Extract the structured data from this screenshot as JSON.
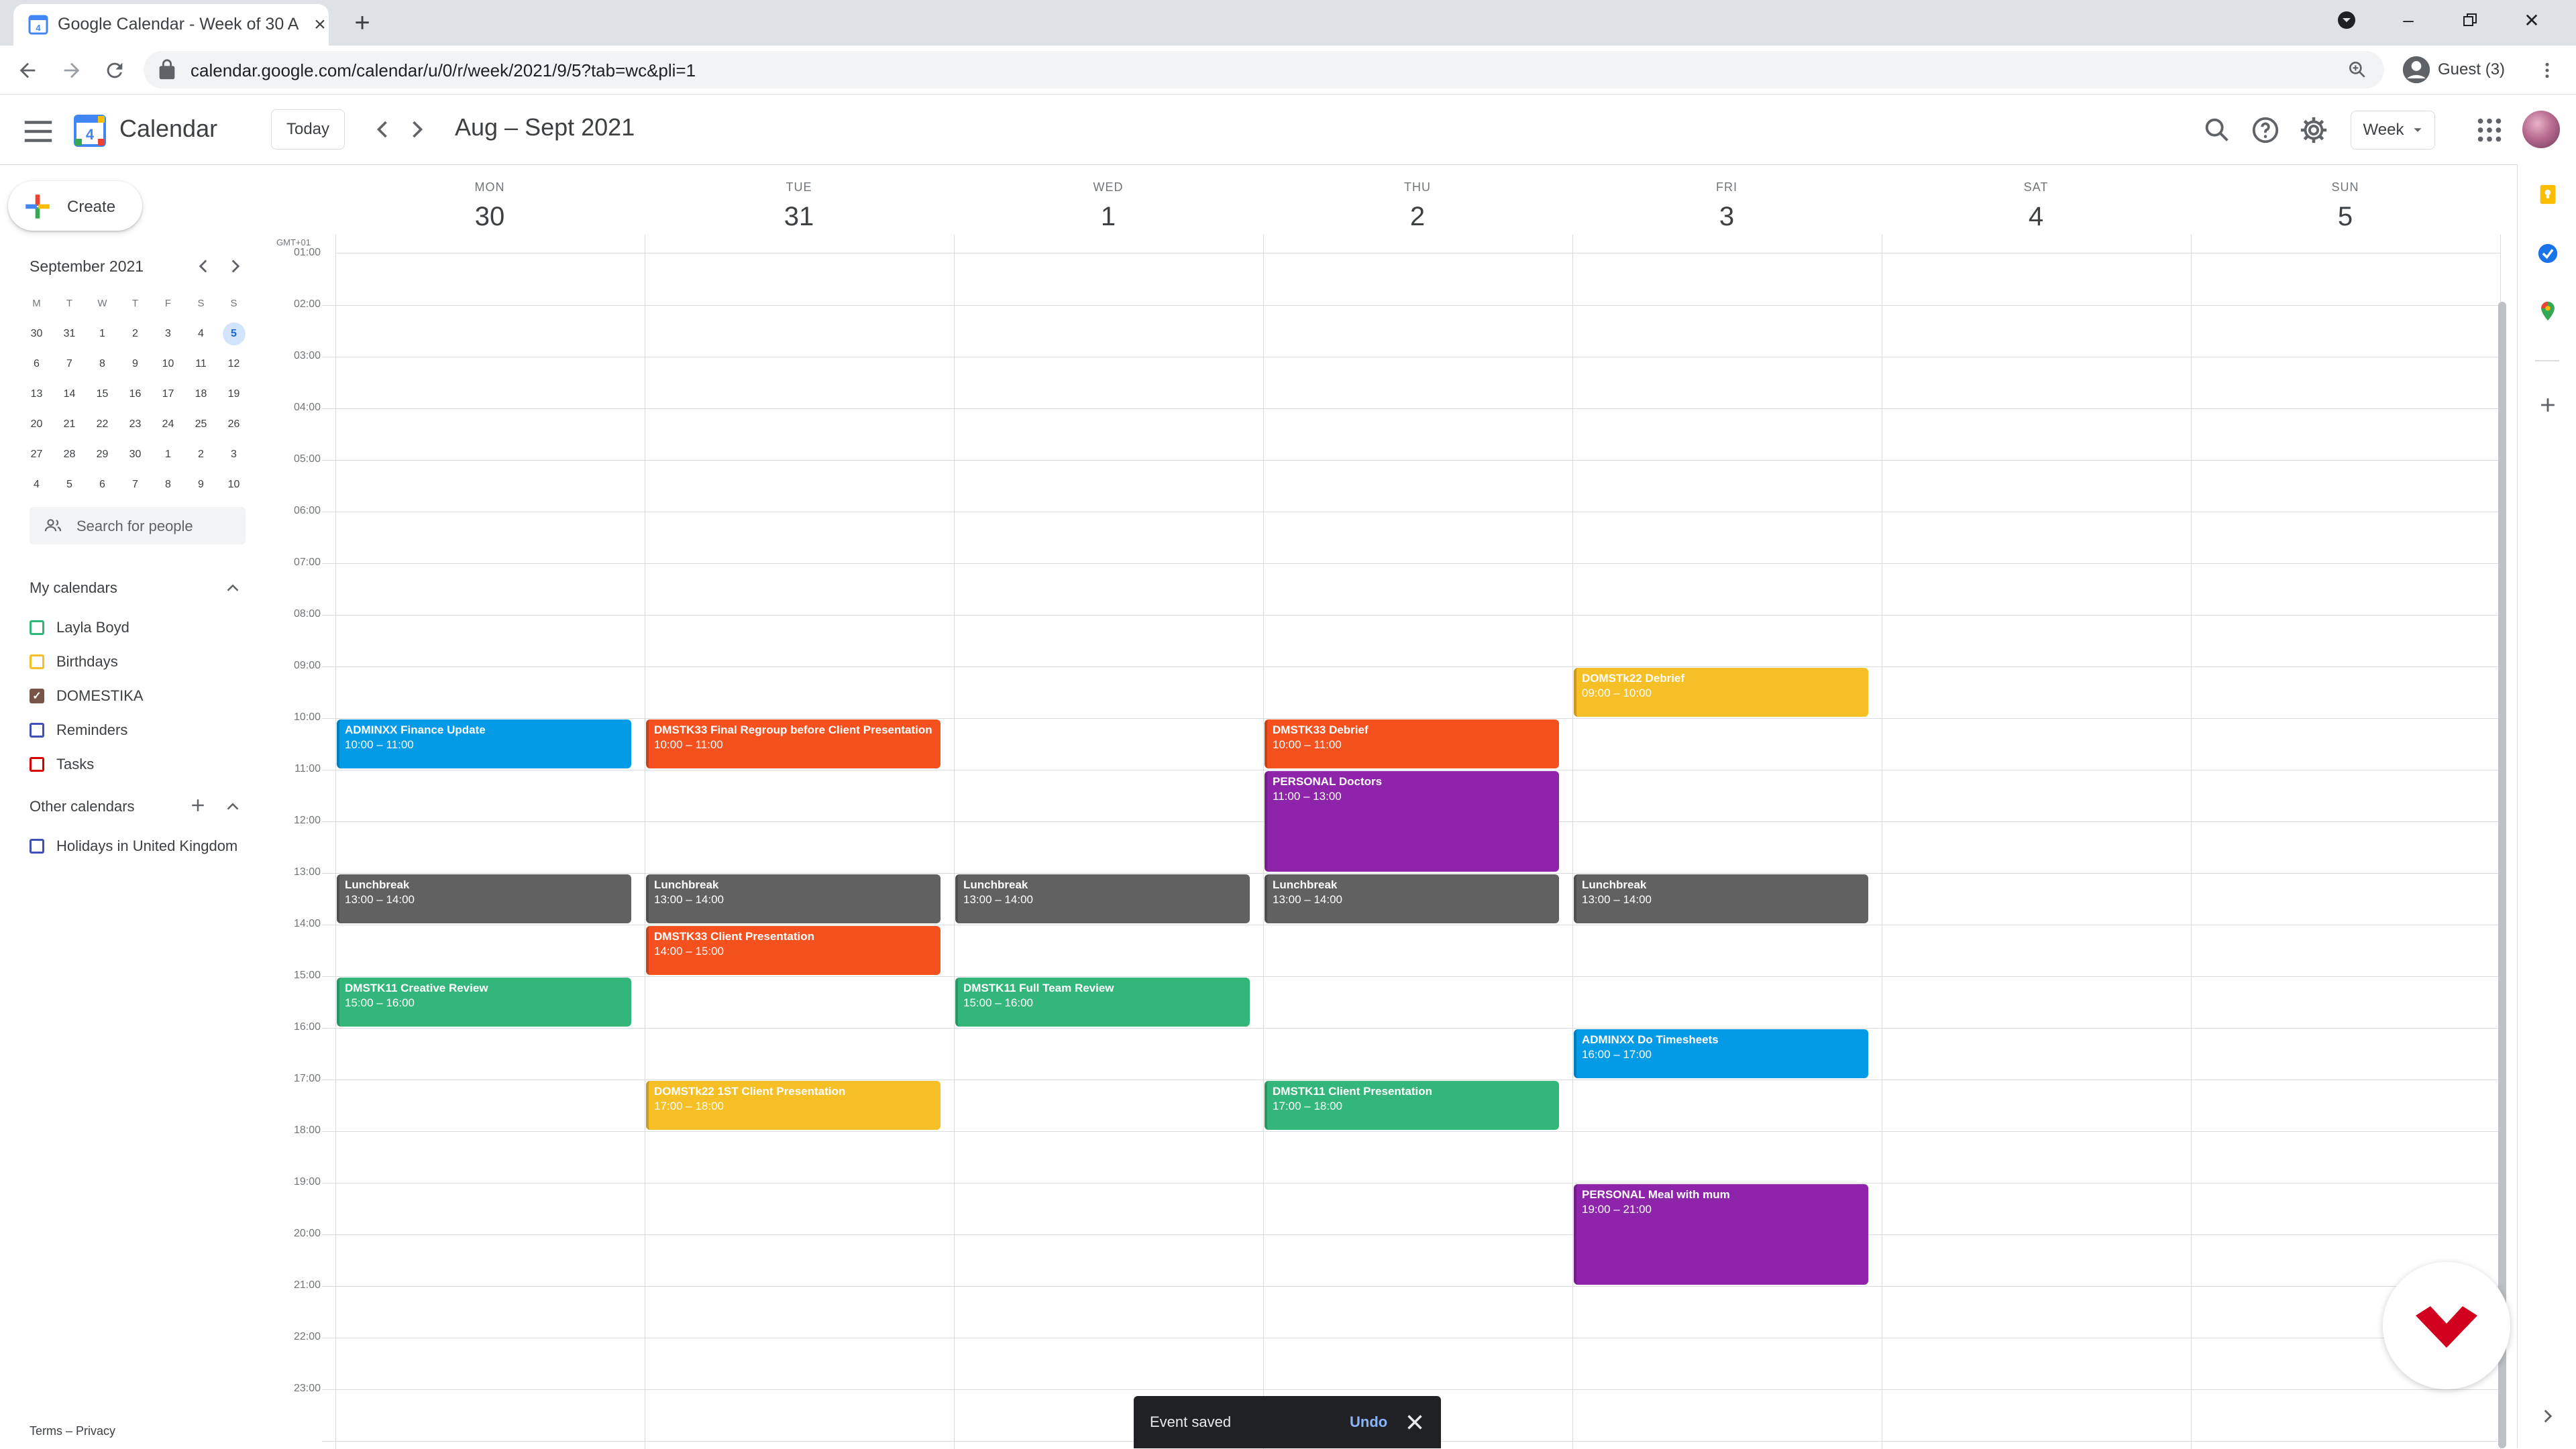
{
  "browser": {
    "tab_title": "Google Calendar - Week of 30 A",
    "url": "calendar.google.com/calendar/u/0/r/week/2021/9/5?tab=wc&pli=1",
    "profile_label": "Guest (3)"
  },
  "header": {
    "app_name": "Calendar",
    "today_label": "Today",
    "range_title": "Aug – Sept 2021",
    "view_label": "Week"
  },
  "sidebar": {
    "create_label": "Create",
    "mini_calendar": {
      "title": "September 2021",
      "weekdays": [
        "M",
        "T",
        "W",
        "T",
        "F",
        "S",
        "S"
      ],
      "weeks": [
        [
          "30",
          "31",
          "1",
          "2",
          "3",
          "4",
          "5"
        ],
        [
          "6",
          "7",
          "8",
          "9",
          "10",
          "11",
          "12"
        ],
        [
          "13",
          "14",
          "15",
          "16",
          "17",
          "18",
          "19"
        ],
        [
          "20",
          "21",
          "22",
          "23",
          "24",
          "25",
          "26"
        ],
        [
          "27",
          "28",
          "29",
          "30",
          "1",
          "2",
          "3"
        ],
        [
          "4",
          "5",
          "6",
          "7",
          "8",
          "9",
          "10"
        ]
      ],
      "today": "5"
    },
    "search_people_placeholder": "Search for people",
    "my_calendars_label": "My calendars",
    "my_calendars": [
      {
        "name": "Layla Boyd",
        "color": "#33b679",
        "checked": false
      },
      {
        "name": "Birthdays",
        "color": "#f6bf26",
        "checked": false
      },
      {
        "name": "DOMESTIKA",
        "color": "#795548",
        "checked": true
      },
      {
        "name": "Reminders",
        "color": "#3f51b5",
        "checked": false
      },
      {
        "name": "Tasks",
        "color": "#d50000",
        "checked": false
      }
    ],
    "other_calendars_label": "Other calendars",
    "other_calendars": [
      {
        "name": "Holidays in United Kingdom",
        "color": "#3f51b5",
        "checked": false
      }
    ],
    "footer": "Terms – Privacy"
  },
  "week": {
    "timezone": "GMT+01",
    "days": [
      {
        "name": "MON",
        "num": "30"
      },
      {
        "name": "TUE",
        "num": "31"
      },
      {
        "name": "WED",
        "num": "1"
      },
      {
        "name": "THU",
        "num": "2"
      },
      {
        "name": "FRI",
        "num": "3"
      },
      {
        "name": "SAT",
        "num": "4"
      },
      {
        "name": "SUN",
        "num": "5"
      }
    ],
    "hours": [
      "01:00",
      "02:00",
      "03:00",
      "04:00",
      "05:00",
      "06:00",
      "07:00",
      "08:00",
      "09:00",
      "10:00",
      "11:00",
      "12:00",
      "13:00",
      "14:00",
      "15:00",
      "16:00",
      "17:00",
      "18:00",
      "19:00",
      "20:00",
      "21:00",
      "22:00",
      "23:00"
    ],
    "events": [
      {
        "day": 0,
        "start": 10,
        "end": 11,
        "title": "ADMINXX Finance Update",
        "time": "10:00 – 11:00",
        "color": "#039be5"
      },
      {
        "day": 0,
        "start": 13,
        "end": 14,
        "title": "Lunchbreak",
        "time": "13:00 – 14:00",
        "color": "#616161"
      },
      {
        "day": 0,
        "start": 15,
        "end": 16,
        "title": "DMSTK11 Creative Review",
        "time": "15:00 – 16:00",
        "color": "#33b679"
      },
      {
        "day": 1,
        "start": 10,
        "end": 11,
        "title": "DMSTK33 Final Regroup before Client Presentation",
        "time": "10:00 – 11:00",
        "color": "#f4511e"
      },
      {
        "day": 1,
        "start": 13,
        "end": 14,
        "title": "Lunchbreak",
        "time": "13:00 – 14:00",
        "color": "#616161"
      },
      {
        "day": 1,
        "start": 14,
        "end": 15,
        "title": "DMSTK33 Client Presentation",
        "time": "14:00 – 15:00",
        "color": "#f4511e"
      },
      {
        "day": 1,
        "start": 17,
        "end": 18,
        "title": "DOMSTk22 1ST Client Presentation",
        "time": "17:00 – 18:00",
        "color": "#f6bf26"
      },
      {
        "day": 2,
        "start": 13,
        "end": 14,
        "title": "Lunchbreak",
        "time": "13:00 – 14:00",
        "color": "#616161"
      },
      {
        "day": 2,
        "start": 15,
        "end": 16,
        "title": "DMSTK11 Full Team Review",
        "time": "15:00 – 16:00",
        "color": "#33b679"
      },
      {
        "day": 3,
        "start": 10,
        "end": 11,
        "title": "DMSTK33 Debrief",
        "time": "10:00 – 11:00",
        "color": "#f4511e"
      },
      {
        "day": 3,
        "start": 11,
        "end": 13,
        "title": "PERSONAL Doctors",
        "time": "11:00 – 13:00",
        "color": "#8e24aa"
      },
      {
        "day": 3,
        "start": 13,
        "end": 14,
        "title": "Lunchbreak",
        "time": "13:00 – 14:00",
        "color": "#616161"
      },
      {
        "day": 3,
        "start": 17,
        "end": 18,
        "title": "DMSTK11 Client Presentation",
        "time": "17:00 – 18:00",
        "color": "#33b679"
      },
      {
        "day": 4,
        "start": 9,
        "end": 10,
        "title": "DOMSTk22 Debrief",
        "time": "09:00 – 10:00",
        "color": "#f6bf26"
      },
      {
        "day": 4,
        "start": 13,
        "end": 14,
        "title": "Lunchbreak",
        "time": "13:00 – 14:00",
        "color": "#616161"
      },
      {
        "day": 4,
        "start": 16,
        "end": 17,
        "title": "ADMINXX Do Timesheets",
        "time": "16:00 – 17:00",
        "color": "#039be5"
      },
      {
        "day": 4,
        "start": 19,
        "end": 21,
        "title": "PERSONAL Meal with mum",
        "time": "19:00 – 21:00",
        "color": "#8e24aa"
      }
    ]
  },
  "snackbar": {
    "text": "Event saved",
    "undo": "Undo"
  }
}
